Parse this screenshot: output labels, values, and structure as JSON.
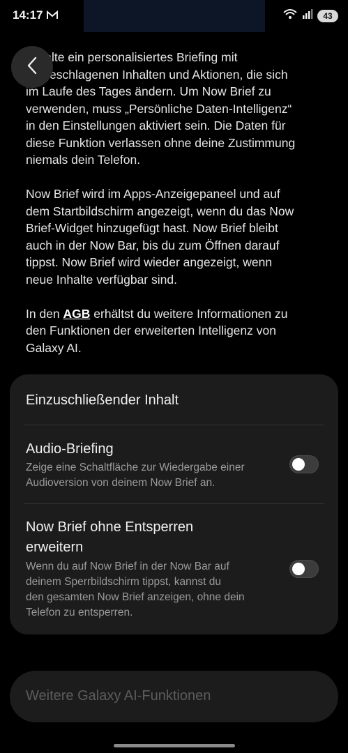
{
  "status_bar": {
    "time": "14:17",
    "battery": "43",
    "icons": [
      "gmail-icon",
      "wifi-icon",
      "signal-icon",
      "battery-icon"
    ]
  },
  "intro": {
    "para1_lines": [
      "Erhalte ein personalisiertes Briefing mit",
      "vorgeschlagenen Inhalten und Aktionen, die sich",
      "im Laufe des Tages ändern. Um Now Brief zu",
      "verwenden, muss „Persönliche Daten-Intelligenz“",
      "in den Einstellungen aktiviert sein. Die Daten für",
      "diese Funktion verlassen ohne deine Zustimmung",
      "niemals dein Telefon."
    ],
    "para2_lines": [
      "Now Brief wird im Apps-Anzeigepaneel und auf",
      "dem Startbildschirm angezeigt, wenn du das Now",
      "Brief-Widget hinzugefügt hast. Now Brief bleibt",
      "auch in der Now Bar, bis du zum Öffnen darauf",
      "tippst. Now Brief wird wieder angezeigt, wenn",
      "neue Inhalte verfügbar sind."
    ],
    "para3_prefix": "In den ",
    "para3_link": "AGB",
    "para3_line1_rest": " erhältst du weitere Informationen zu",
    "para3_line2": "den Funktionen der erweiterten Intelligenz von",
    "para3_line3": "Galaxy AI."
  },
  "card": {
    "title": "Einzuschließender Inhalt",
    "settings": [
      {
        "title_lines": [
          "Audio-Briefing"
        ],
        "desc_lines": [
          "Zeige eine Schaltfläche zur Wiedergabe einer",
          "Audioversion von deinem Now Brief an."
        ],
        "enabled": false
      },
      {
        "title_lines": [
          "Now Brief ohne Entsperren",
          "erweitern"
        ],
        "desc_lines": [
          "Wenn du auf Now Brief in der Now Bar auf",
          "deinem Sperrbildschirm tippst, kannst du",
          "den gesamten Now Brief anzeigen, ohne dein",
          "Telefon zu entsperren."
        ],
        "enabled": false
      }
    ]
  },
  "more_button": {
    "label": "Weitere Galaxy AI-Funktionen"
  },
  "colors": {
    "background": "#000000",
    "card": "#1c1c1c",
    "text": "#e6e6e6",
    "muted": "#9a9a9a",
    "disabled": "#5c5c5c"
  }
}
